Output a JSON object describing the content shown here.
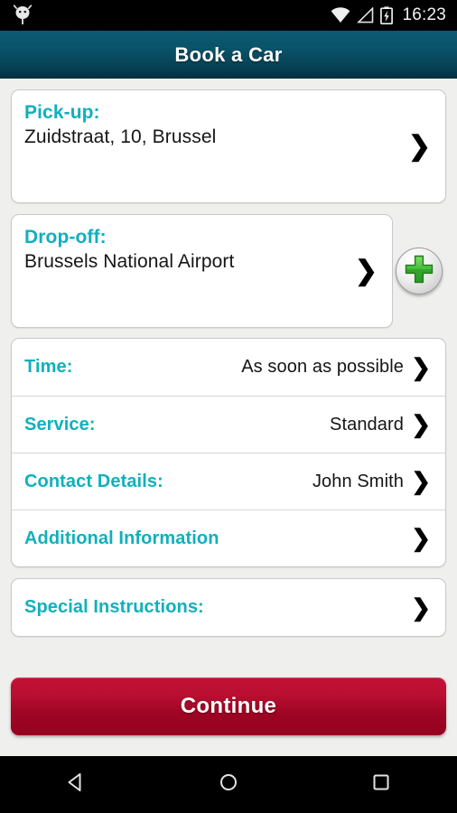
{
  "status_bar": {
    "notification_icon": "android-robot-icon",
    "wifi_icon": "wifi-icon",
    "signal_icon": "cell-signal-icon",
    "battery_icon": "battery-charging-icon",
    "time": "16:23"
  },
  "header": {
    "title": "Book a Car",
    "gradient_top": "#0b5a72",
    "gradient_bottom": "#042e3e"
  },
  "theme": {
    "accent_teal": "#10b0bd",
    "background": "#efefee",
    "card_background": "#ffffff",
    "card_border": "#c8c8c8",
    "primary_button": "#b00d2e",
    "add_button_green": "#4cc247"
  },
  "location_cards": [
    {
      "label": "Pick-up:",
      "value": "Zuidstraat, 10, Brussel",
      "chevron": "❯"
    },
    {
      "label": "Drop-off:",
      "value": "Brussels National Airport",
      "chevron": "❯"
    }
  ],
  "add_stop_button": {
    "icon": "plus-icon",
    "label": "+"
  },
  "detail_group": [
    {
      "label": "Time:",
      "value": "As soon as possible",
      "chevron": "❯"
    },
    {
      "label": "Service:",
      "value": "Standard",
      "chevron": "❯"
    },
    {
      "label": "Contact Details:",
      "value": "John Smith",
      "chevron": "❯"
    },
    {
      "label": "Additional Information",
      "value": "",
      "chevron": "❯"
    }
  ],
  "special_instructions": {
    "label": "Special Instructions:",
    "value": "",
    "chevron": "❯"
  },
  "continue_button": {
    "label": "Continue"
  },
  "nav_bar": {
    "back": "back-triangle-icon",
    "home": "home-circle-icon",
    "recents": "recents-square-icon"
  }
}
